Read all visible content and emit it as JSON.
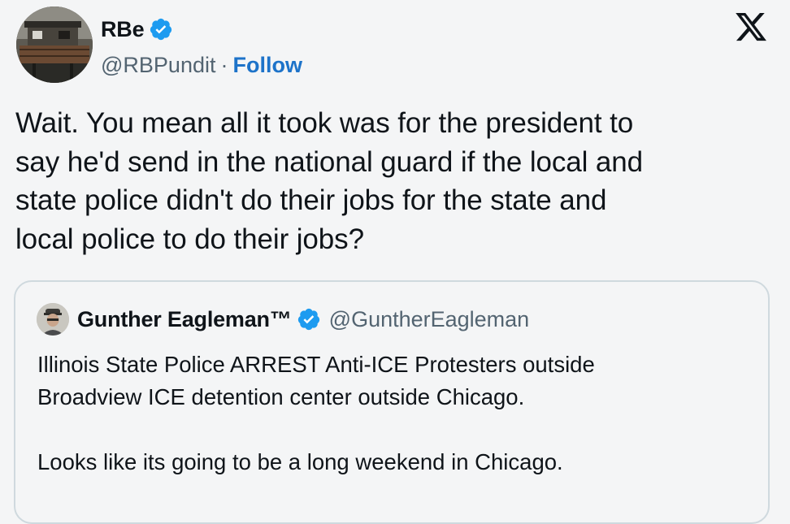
{
  "author": {
    "display_name": "RBe",
    "handle": "@RBPundit",
    "separator": "·",
    "follow_label": "Follow",
    "avatar_icon": "profile-photo-icon",
    "verified_icon": "verified-badge-icon"
  },
  "brand": {
    "logo_icon": "x-logo-icon"
  },
  "tweet": {
    "text": "Wait. You mean all it took was for the president to\nsay he'd send in the national guard if the local and\nstate police didn't do their jobs for the state and\nlocal police to do their jobs?"
  },
  "quoted_tweet": {
    "display_name": "Gunther Eagleman™",
    "handle": "@GuntherEagleman",
    "text": "Illinois State Police ARREST Anti-ICE Protesters outside\nBroadview ICE detention center outside Chicago.\n\nLooks like its going to be a long weekend in Chicago.",
    "avatar_icon": "profile-photo-icon",
    "verified_icon": "verified-badge-icon"
  },
  "colors": {
    "background": "#f4f5f6",
    "text": "#0f1419",
    "secondary_text": "#536471",
    "link": "#1d73c9",
    "verified": "#1d9bf0",
    "border": "#cfd9de"
  }
}
